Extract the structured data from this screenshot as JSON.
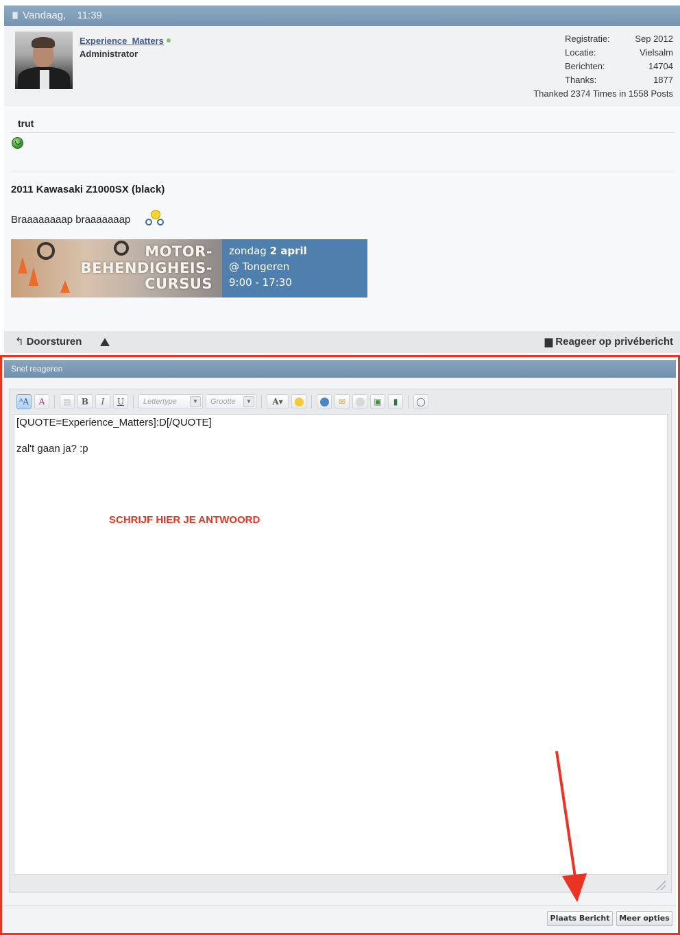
{
  "post": {
    "date": "Vandaag,",
    "time": "11:39",
    "username": "Experience_Matters",
    "usertitle": "Administrator",
    "stats": [
      {
        "label": "Registratie:",
        "value": "Sep 2012"
      },
      {
        "label": "Locatie:",
        "value": "Vielsalm"
      },
      {
        "label": "Berichten:",
        "value": "14704"
      },
      {
        "label": "Thanks:",
        "value": "1877"
      }
    ],
    "thanked": "Thanked 2374 Times in 1558 Posts",
    "title": "trut",
    "signature": {
      "bike": "2011 Kawasaki Z1000SX (black)",
      "text": "Braaaaaaaap braaaaaaap"
    },
    "banner": {
      "line1": "MOTOR-",
      "line2": "BEHENDIGHEIS-",
      "line3": "CURSUS",
      "day": "zondag",
      "date": "2 april",
      "place": "@ Tongeren",
      "hours": "9:00 - 17:30"
    },
    "actions": {
      "forward": "Doorsturen",
      "reply_pm": "Reageer op privébericht"
    }
  },
  "quick_reply": {
    "title": "Snel reageren",
    "font_select": "Lettertype",
    "size_select": "Grootte",
    "text_line1": "[QUOTE=Experience_Matters]:D[/QUOTE]",
    "text_line2": "zal't gaan ja? :p",
    "annotation": "SCHRIJF HIER JE ANTWOORD",
    "submit": "Plaats Bericht",
    "more": "Meer opties"
  },
  "colors": {
    "header_blue": "#7594b0",
    "link_blue": "#3e5c92",
    "annotation_red": "#ea3323",
    "banner_blue": "#4f7fad"
  }
}
